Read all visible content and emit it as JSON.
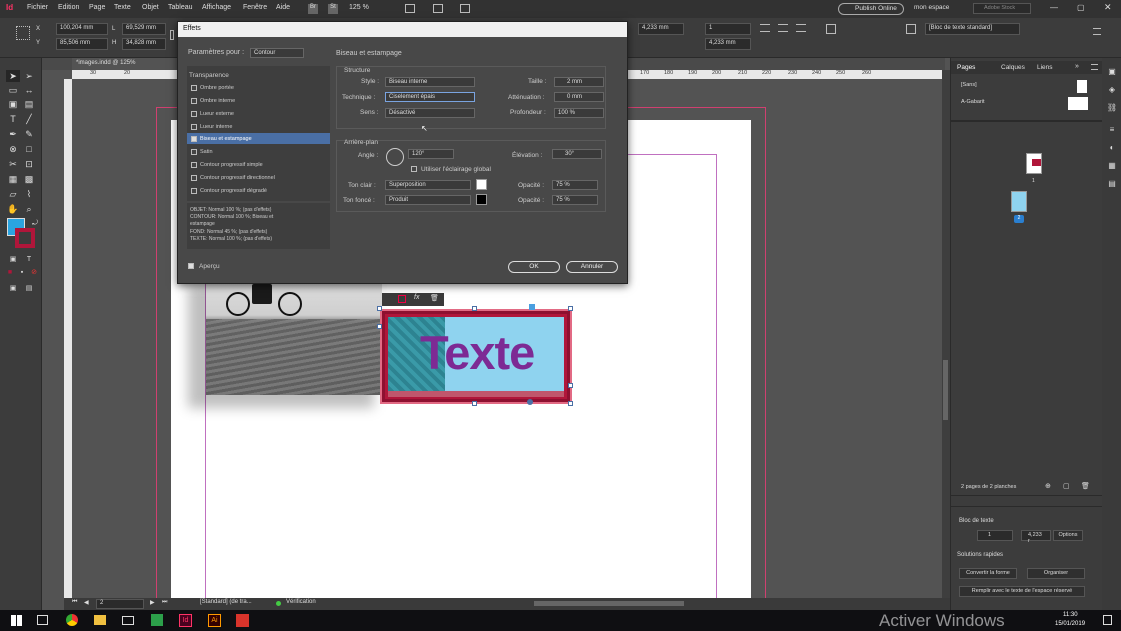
{
  "menu": {
    "items": [
      "Fichier",
      "Edition",
      "Page",
      "Texte",
      "Objet",
      "Tableau",
      "Affichage",
      "Fenêtre",
      "Aide"
    ]
  },
  "appbar": {
    "zoom": "125 %",
    "stock_search": "Adobe Stock",
    "publish": "Publish Online",
    "workspace": "mon espace"
  },
  "control": {
    "x": "100,204 mm",
    "y": "85,506 mm",
    "w": "69,529 mm",
    "h": "34,828 mm",
    "size1": "4,233 mm",
    "size2": "4,233 mm",
    "cols": "1",
    "style": "[Bloc de texte standard]"
  },
  "document": {
    "tab": "*images.indd @ 125%",
    "canvas_text": "Texte",
    "ruler_marks": [
      "30",
      "20",
      "170",
      "180",
      "190",
      "200",
      "210",
      "220",
      "230",
      "240",
      "250",
      "260"
    ]
  },
  "status": {
    "page": "2",
    "master": "[Standard] (de tra...",
    "preflight": "Vérification"
  },
  "pages_panel": {
    "tabs": [
      "Pages",
      "Calques",
      "Liens"
    ],
    "none_master": "[Sans]",
    "a_master": "A-Gabarit",
    "page_numbers": [
      "1",
      "2"
    ],
    "summary": "2 pages de 2 planches",
    "frame_section": "Bloc de texte",
    "cols": "1",
    "gutter": "4,233 r",
    "options_btn": "Options",
    "quick_actions": "Solutions rapides",
    "convert_btn": "Convertir la forme",
    "organize_btn": "Organiser",
    "fill_btn": "Remplir avec le texte de l'espace réservé"
  },
  "dialog": {
    "title": "Effets",
    "settings_label": "Paramètres pour :",
    "settings_value": "Contour",
    "effects_list": [
      "Transparence",
      "Ombre portée",
      "Ombre interne",
      "Lueur externe",
      "Lueur interne",
      "Biseau et estampage",
      "Satin",
      "Contour progressif simple",
      "Contour progressif directionnel",
      "Contour progressif dégradé"
    ],
    "summary": [
      "OBJET: Normal 100 %; (pas d'effets)",
      "CONTOUR: Normal 100 %; Biseau et estampage",
      "FOND: Normal 45 %; (pas d'effets)",
      "TEXTE: Normal 100 %; (pas d'effets)"
    ],
    "preview_label": "Aperçu",
    "section_title": "Biseau et estampage",
    "structure": "Structure",
    "style_label": "Style :",
    "style_value": "Biseau interne",
    "technique_label": "Technique :",
    "technique_value": "Ciselement épais",
    "direction_label": "Sens :",
    "direction_value": "Désactivé",
    "size_label": "Taille :",
    "size_value": "2 mm",
    "soften_label": "Atténuation :",
    "soften_value": "0 mm",
    "depth_label": "Profondeur :",
    "depth_value": "100 %",
    "shading": "Arrière-plan",
    "angle_label": "Angle :",
    "angle_value": "120°",
    "global_light": "Utiliser l'éclairage global",
    "altitude_label": "Élévation :",
    "altitude_value": "30°",
    "highlight_label": "Ton clair :",
    "highlight_value": "Superposition",
    "highlight_opacity_label": "Opacité :",
    "highlight_opacity": "75 %",
    "shadow_label": "Ton foncé :",
    "shadow_value": "Produit",
    "shadow_opacity_label": "Opacité :",
    "shadow_opacity": "75 %",
    "ok": "OK",
    "cancel": "Annuler"
  },
  "taskbar": {
    "time": "11:30",
    "date": "15/01/2019",
    "watermark": "Activer Windows"
  },
  "colors": {
    "dialog_bg": "#484848",
    "selection": "#4a6fa5",
    "frame_red": "#b0163a",
    "fill_blue": "#8fd3ef",
    "text_purple": "#7d2a94"
  }
}
